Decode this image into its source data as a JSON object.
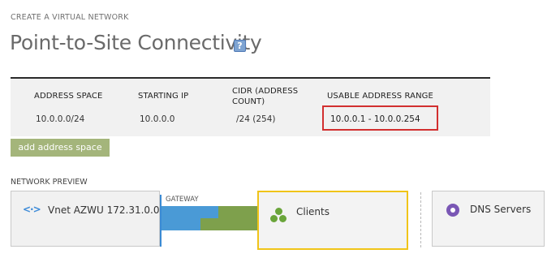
{
  "header": {
    "subtitle": "CREATE A VIRTUAL NETWORK",
    "title": "Point-to-Site Connectivity",
    "help_icon": "help-icon"
  },
  "address_table": {
    "columns": {
      "address_space": "ADDRESS SPACE",
      "starting_ip": "STARTING IP",
      "cidr_line1": "CIDR (ADDRESS",
      "cidr_line2": "COUNT)",
      "usable_range": "USABLE ADDRESS RANGE"
    },
    "row": {
      "address_space": "10.0.0.0/24",
      "starting_ip": "10.0.0.0",
      "cidr": "/24 (254)",
      "usable_range": "10.0.0.1 - 10.0.0.254"
    }
  },
  "add_button": {
    "label": "add address space",
    "color": "#a4b57b"
  },
  "network_preview": {
    "label": "NETWORK PREVIEW",
    "vnet": {
      "icon": "vnet-icon",
      "label": "Vnet AZWU 172.31.0.0"
    },
    "gateway": {
      "label": "GATEWAY"
    },
    "clients": {
      "icon": "clients-icon",
      "label": "Clients",
      "highlight_color": "#f0c419"
    },
    "dns": {
      "icon": "dns-servers-icon",
      "label": "DNS Servers"
    }
  },
  "colors": {
    "gateway_blue": "#4a9ad6",
    "gateway_green": "#7ea04c",
    "range_highlight": "#d22f2f"
  }
}
